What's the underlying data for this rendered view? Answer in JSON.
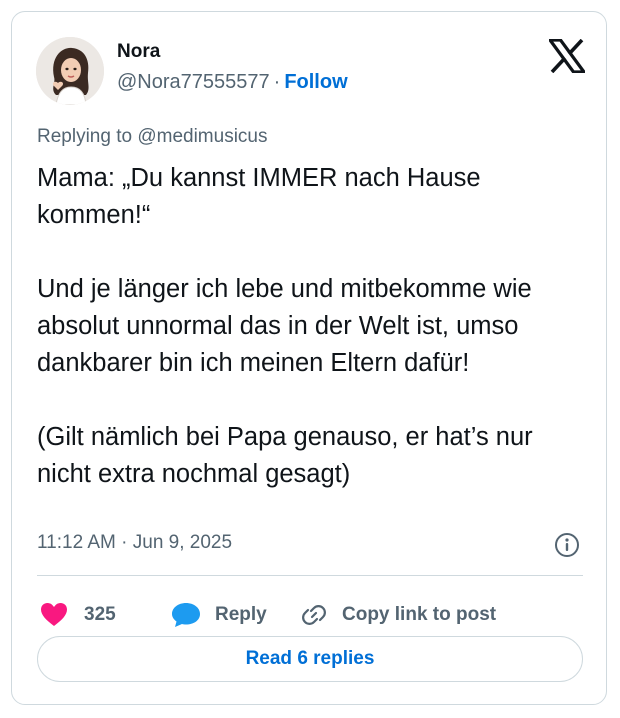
{
  "author": {
    "name": "Nora",
    "handle": "@Nora77555577",
    "separator": "·",
    "follow_label": "Follow",
    "avatar": "avatar-illustration-icon"
  },
  "brand_icon": "x-logo-icon",
  "replying_to": "Replying to @medimusicus",
  "tweet": {
    "paragraphs": [
      "Mama: „Du kannst IMMER nach Hause kommen!“",
      "Und je länger ich lebe und mitbekomme wie absolut unnormal das in der Welt ist, umso dankbarer bin ich meinen Eltern dafür!",
      "(Gilt nämlich bei Papa genauso, er hat’s nur nicht extra nochmal gesagt)"
    ]
  },
  "timestamp": "11:12 AM · Jun 9, 2025",
  "info_icon": "info-icon",
  "actions": {
    "like_count": "325",
    "reply_label": "Reply",
    "copy_label": "Copy link to post"
  },
  "read_replies_label": "Read 6 replies",
  "colors": {
    "accent": "#006fd6",
    "like": "#f91880",
    "reply_bubble": "#1d9bf0",
    "text": "#0f1419",
    "muted": "#536471",
    "border": "#cfd9de"
  }
}
